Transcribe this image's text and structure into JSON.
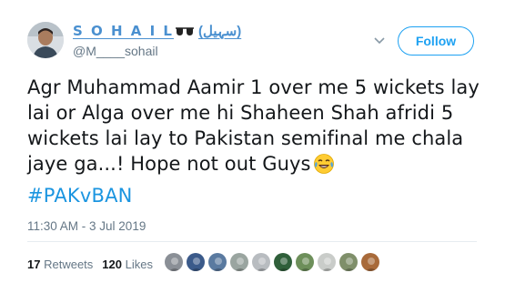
{
  "author": {
    "display_name": "S O H A I L",
    "name_suffix": "(سہیل)",
    "handle": "@M____sohail"
  },
  "follow_button_label": "Follow",
  "tweet": {
    "text": "Agr Muhammad Aamir 1 over me 5 wickets lay lai or Alga over me hi Shaheen Shah afridi 5 wickets lai lay to Pakistan semifinal me chala jaye ga...! Hope not out Guys",
    "hashtag": "#PAKvBAN",
    "timestamp": "11:30 AM - 3 Jul 2019"
  },
  "stats": {
    "retweets_count": "17",
    "retweets_label": "Retweets",
    "likes_count": "120",
    "likes_label": "Likes"
  },
  "likers": [
    {
      "name": "liker-1",
      "color": "#8a8f96"
    },
    {
      "name": "liker-2",
      "color": "#3b5a8a"
    },
    {
      "name": "liker-3",
      "color": "#5a7aa0"
    },
    {
      "name": "liker-4",
      "color": "#9aa5a0"
    },
    {
      "name": "liker-5",
      "color": "#b8bcc0"
    },
    {
      "name": "liker-6",
      "color": "#2f5f3a"
    },
    {
      "name": "liker-7",
      "color": "#6d8f5a"
    },
    {
      "name": "liker-8",
      "color": "#c9ccc9"
    },
    {
      "name": "liker-9",
      "color": "#7f8f6a"
    },
    {
      "name": "liker-10",
      "color": "#a86a3a"
    }
  ],
  "colors": {
    "link": "#1da1f2",
    "hashtag": "#1b95e0",
    "name": "#4a90d0",
    "muted": "#657786"
  }
}
